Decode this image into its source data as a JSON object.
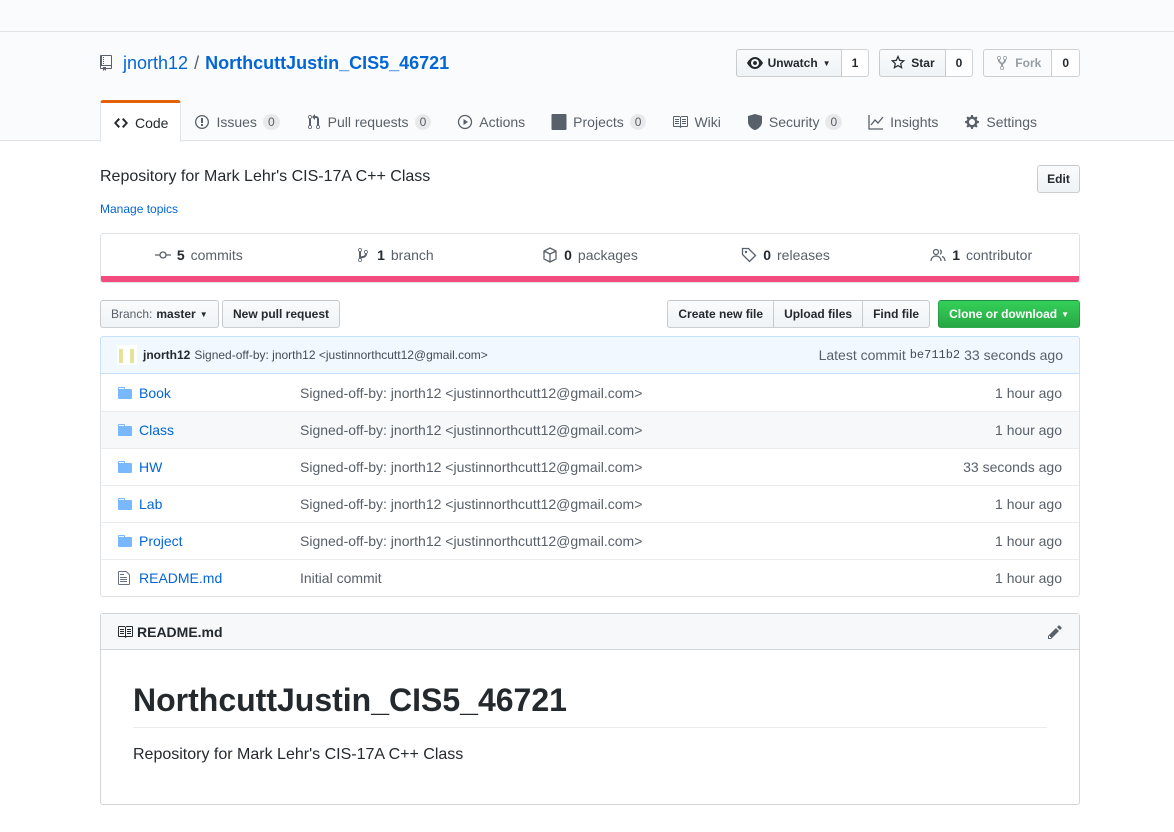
{
  "repo": {
    "owner": "jnorth12",
    "separator": "/",
    "name": "NorthcuttJustin_CIS5_46721",
    "description": "Repository for Mark Lehr's CIS-17A C++ Class",
    "manage_topics": "Manage topics",
    "edit_label": "Edit"
  },
  "actions": {
    "watch_label": "Unwatch",
    "watch_count": "1",
    "star_label": "Star",
    "star_count": "0",
    "fork_label": "Fork",
    "fork_count": "0"
  },
  "nav": {
    "code": "Code",
    "issues": "Issues",
    "issues_count": "0",
    "pulls": "Pull requests",
    "pulls_count": "0",
    "actions": "Actions",
    "projects": "Projects",
    "projects_count": "0",
    "wiki": "Wiki",
    "security": "Security",
    "security_count": "0",
    "insights": "Insights",
    "settings": "Settings"
  },
  "summary": {
    "commits_num": "5",
    "commits_label": "commits",
    "branch_num": "1",
    "branch_label": "branch",
    "packages_num": "0",
    "packages_label": "packages",
    "releases_num": "0",
    "releases_label": "releases",
    "contributor_num": "1",
    "contributor_label": "contributor",
    "language_color": "#f34b7d"
  },
  "filenav": {
    "branch_prefix": "Branch:",
    "branch_name": "master",
    "new_pr": "New pull request",
    "create_file": "Create new file",
    "upload_files": "Upload files",
    "find_file": "Find file",
    "clone": "Clone or download"
  },
  "latest_commit": {
    "author": "jnorth12",
    "message": "Signed-off-by: jnorth12 <justinnorthcutt12@gmail.com>",
    "label": "Latest commit",
    "sha": "be711b2",
    "age": "33 seconds ago"
  },
  "files": [
    {
      "type": "folder",
      "name": "Book",
      "message": "Signed-off-by: jnorth12 <justinnorthcutt12@gmail.com>",
      "age": "1 hour ago"
    },
    {
      "type": "folder",
      "name": "Class",
      "message": "Signed-off-by: jnorth12 <justinnorthcutt12@gmail.com>",
      "age": "1 hour ago"
    },
    {
      "type": "folder",
      "name": "HW",
      "message": "Signed-off-by: jnorth12 <justinnorthcutt12@gmail.com>",
      "age": "33 seconds ago"
    },
    {
      "type": "folder",
      "name": "Lab",
      "message": "Signed-off-by: jnorth12 <justinnorthcutt12@gmail.com>",
      "age": "1 hour ago"
    },
    {
      "type": "folder",
      "name": "Project",
      "message": "Signed-off-by: jnorth12 <justinnorthcutt12@gmail.com>",
      "age": "1 hour ago"
    },
    {
      "type": "file",
      "name": "README.md",
      "message": "Initial commit",
      "age": "1 hour ago"
    }
  ],
  "readme": {
    "filename": "README.md",
    "heading": "NorthcuttJustin_CIS5_46721",
    "body": "Repository for Mark Lehr's CIS-17A C++ Class"
  }
}
